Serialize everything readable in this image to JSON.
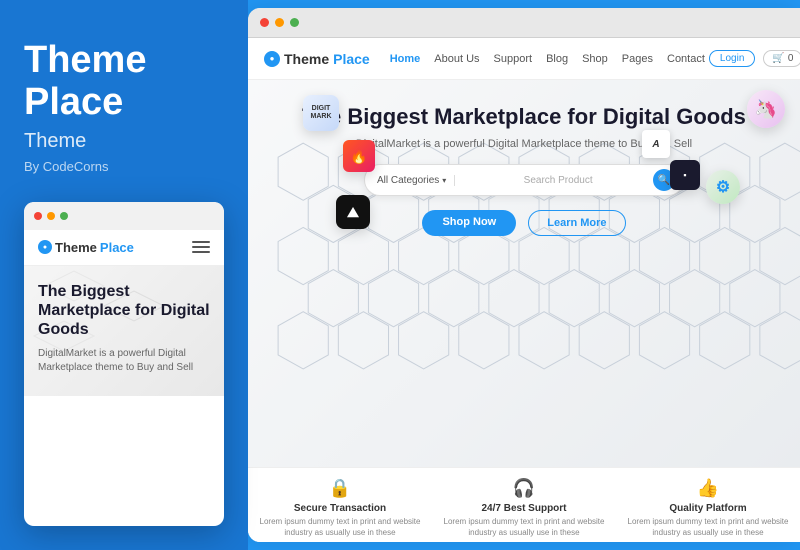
{
  "leftPanel": {
    "title_line1": "Theme",
    "title_line2": "Place",
    "subtitle": "Theme",
    "author": "By CodeCorns"
  },
  "mobilePreview": {
    "logo_theme": "Theme",
    "logo_place": "Place",
    "hero_title": "The Biggest Marketplace for Digital Goods",
    "hero_desc": "DigitalMarket is a powerful Digital Marketplace theme to Buy and Sell"
  },
  "siteNav": {
    "logo_theme": "Theme",
    "logo_place": "Place",
    "items": [
      {
        "label": "Home",
        "active": true
      },
      {
        "label": "About Us",
        "active": false
      },
      {
        "label": "Support",
        "active": false
      },
      {
        "label": "Blog",
        "active": false
      },
      {
        "label": "Shop",
        "active": false
      },
      {
        "label": "Pages",
        "active": false
      },
      {
        "label": "Contact",
        "active": false
      }
    ],
    "login_label": "Login",
    "cart_label": "0"
  },
  "hero": {
    "title": "The Biggest Marketplace for Digital Goods",
    "desc": "DigitalMarket is a powerful Digital Marketplace theme to Buy and Sell",
    "search_placeholder": "Search Product",
    "search_category": "All Categories",
    "btn_shop": "Shop Now",
    "btn_learn": "Learn More"
  },
  "features": [
    {
      "icon": "🔒",
      "title": "Secure Transaction",
      "desc": "Lorem ipsum dummy text in print and website industry as usually use in these"
    },
    {
      "icon": "🎧",
      "title": "24/7 Best Support",
      "desc": "Lorem ipsum dummy text in print and website industry as usually use in these"
    },
    {
      "icon": "👍",
      "title": "Quality Platform",
      "desc": "Lorem ipsum dummy text in print and website industry as usually use in these"
    }
  ]
}
